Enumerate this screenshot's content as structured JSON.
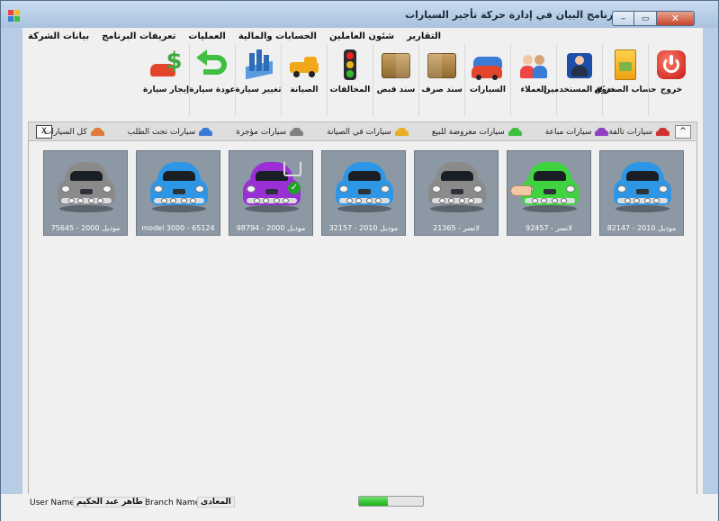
{
  "window": {
    "title": "برنامج البيان في إدارة حركة تأجير السيارات",
    "controls": {
      "minimize": "‒",
      "maximize": "▭",
      "close": "✕"
    }
  },
  "menu": [
    {
      "label": "بيانات الشركة"
    },
    {
      "label": "تعريفات البرنامج"
    },
    {
      "label": "العمليات"
    },
    {
      "label": "الحسابات والمالية"
    },
    {
      "label": "شئون العاملين"
    },
    {
      "label": "التقارير"
    }
  ],
  "toolbar": [
    {
      "label": "خروج",
      "icon": "power-icon"
    },
    {
      "label": "حساب الصندوق",
      "icon": "cashbox-icon"
    },
    {
      "label": "حركة المستخدمين",
      "icon": "user-activity-icon"
    },
    {
      "label": "العملاء",
      "icon": "customers-icon"
    },
    {
      "label": "السيارات",
      "icon": "cars-icon"
    },
    {
      "label": "سند صرف",
      "icon": "payment-voucher-icon"
    },
    {
      "label": "سند قبض",
      "icon": "receipt-voucher-icon"
    },
    {
      "label": "المخالفات",
      "icon": "traffic-light-icon"
    },
    {
      "label": "الصيانة",
      "icon": "tow-truck-icon"
    },
    {
      "label": "تغيير سيارة",
      "icon": "car-swap-icon"
    },
    {
      "label": "عودة سيارة",
      "icon": "return-arrow-icon"
    },
    {
      "label": "إيجار سيارة",
      "icon": "rent-car-icon"
    }
  ],
  "filters": [
    {
      "label": "كل السيارات",
      "color": "#e07a3a"
    },
    {
      "label": "سيارات تحت الطلب",
      "color": "#3a7bd5"
    },
    {
      "label": "سيارات مؤجرة",
      "color": "#808080"
    },
    {
      "label": "سيارات في الصيانة",
      "color": "#e8b020"
    },
    {
      "label": "سيارات معروضة للبيع",
      "color": "#3fbf3f"
    },
    {
      "label": "سيارات مباعة",
      "color": "#8e3fc4"
    },
    {
      "label": "سيارات تالفة",
      "color": "#d23030"
    }
  ],
  "filter_controls": {
    "close": "X",
    "collapse": "^"
  },
  "cars": [
    {
      "caption": "موديل 2010 - 82147",
      "color": "#2d97e6",
      "overlay": ""
    },
    {
      "caption": "لانسر - 92457",
      "color": "#3fd43f",
      "overlay": "hand"
    },
    {
      "caption": "لانسر - 21365",
      "color": "#8a8a8a",
      "overlay": ""
    },
    {
      "caption": "موديل 2010 - 32157",
      "color": "#2d97e6",
      "overlay": ""
    },
    {
      "caption": "موديل 2000 - 98794",
      "color": "#9a2fd6",
      "overlay": "cart"
    },
    {
      "caption": "model 3000 - 65124",
      "color": "#2d97e6",
      "overlay": ""
    },
    {
      "caption": "موديل 2000 - 75645",
      "color": "#8a8a8a",
      "overlay": ""
    }
  ],
  "status": {
    "user_name_label": "User Name:",
    "user_name": "طاهر عبد الحكيم",
    "branch_name_label": "Branch Name:",
    "branch_name": "المعادى",
    "progress": 0.45
  }
}
